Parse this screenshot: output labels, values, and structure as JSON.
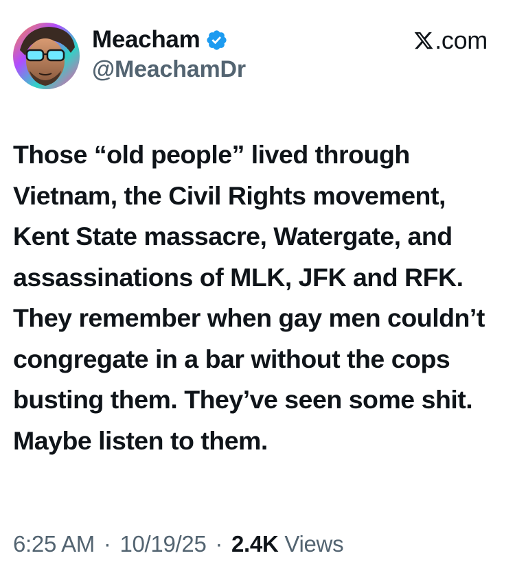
{
  "author": {
    "display_name": "Meacham",
    "handle": "@MeachamDr",
    "verified": true,
    "avatar_icon": "profile-avatar"
  },
  "brand": {
    "label": ".com",
    "logo_icon": "x-logo-icon"
  },
  "tweet": {
    "text": "Those “old people” lived through Vietnam, the Civil Rights movement, Kent State massacre, Watergate, and assassinations of MLK, JFK and RFK. They remember when gay men couldn’t congregate in a bar without the cops busting them. They’ve seen some shit. Maybe listen to them."
  },
  "meta": {
    "time": "6:25 AM",
    "separator": "·",
    "date": "10/19/25",
    "views_count": "2.4K",
    "views_label": "Views"
  },
  "colors": {
    "text_primary": "#0f1419",
    "text_secondary": "#536471",
    "verified_blue": "#1d9bf0",
    "background": "#ffffff"
  }
}
